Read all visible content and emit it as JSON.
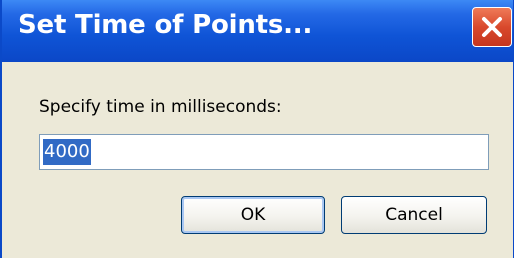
{
  "window": {
    "title": "Set Time of Points..."
  },
  "titlebar": {
    "close_icon": "close-icon"
  },
  "dialog": {
    "prompt": "Specify time in milliseconds:",
    "input_value": "4000",
    "ok_label": "OK",
    "cancel_label": "Cancel"
  },
  "colors": {
    "titlebar": "#0f54d6",
    "close_button": "#d9492c",
    "dialog_background": "#ece9d8",
    "selection": "#316ac5"
  }
}
